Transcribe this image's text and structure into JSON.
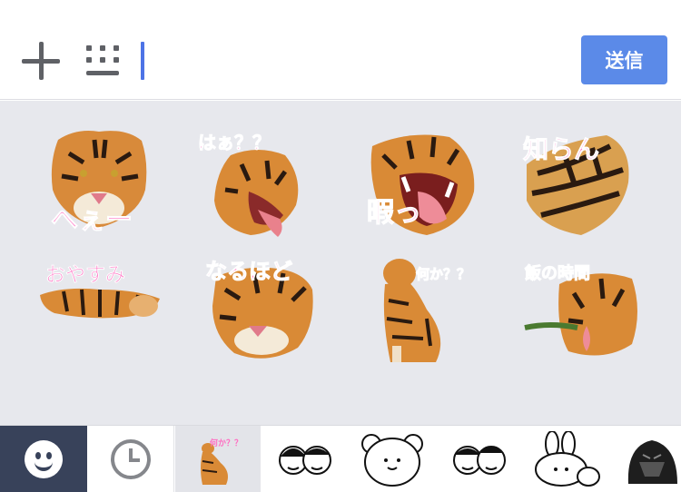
{
  "input_bar": {
    "send_label": "送信"
  },
  "stickers": [
    {
      "caption": "へぇー"
    },
    {
      "caption": "はぁ？？"
    },
    {
      "caption": "暇っ"
    },
    {
      "caption": "知らん"
    },
    {
      "caption": "おやすみ"
    },
    {
      "caption": "なるほど"
    },
    {
      "caption": "何か？？"
    },
    {
      "caption": "飯の時間"
    }
  ],
  "tabs": {
    "tiger_pack_caption": "何か？？"
  },
  "colors": {
    "accent": "#5b8ae8",
    "caption": "#ff6fc2",
    "panel_bg": "#e7e8ed",
    "active_tab": "#38425a"
  }
}
